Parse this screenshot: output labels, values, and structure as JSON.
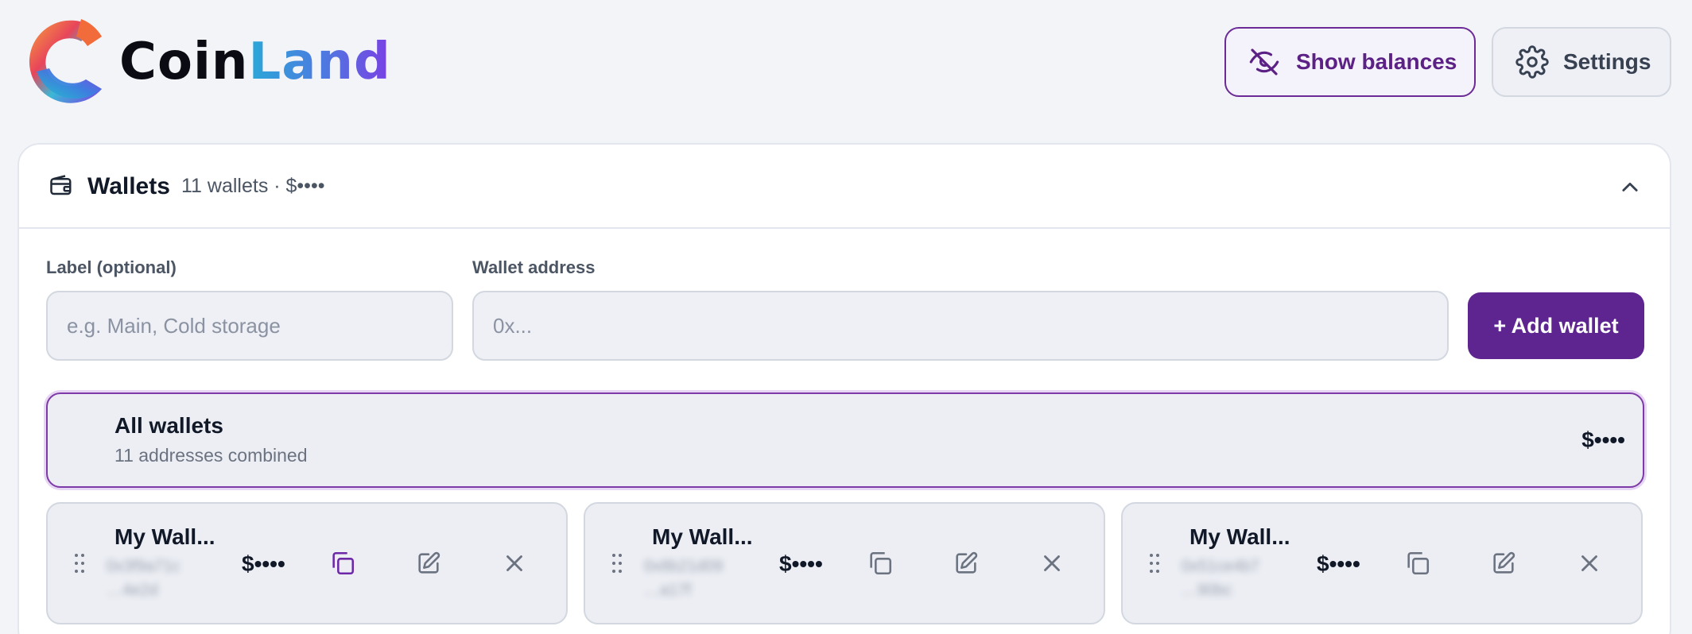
{
  "app": {
    "logo_text_1": "Coin",
    "logo_text_2": "Land",
    "brand_color": "#5e2590"
  },
  "header": {
    "show_balances_label": "Show balances",
    "settings_label": "Settings"
  },
  "wallets_panel": {
    "title": "Wallets",
    "meta": "11 wallets · $••••",
    "label_field": {
      "label": "Label (optional)",
      "placeholder": "e.g. Main, Cold storage",
      "value": ""
    },
    "address_field": {
      "label": "Wallet address",
      "placeholder": "0x...",
      "value": ""
    },
    "add_button_label": "+ Add wallet",
    "all_wallets": {
      "title": "All wallets",
      "subtitle": "11 addresses combined",
      "balance": "$••••"
    },
    "wallets": [
      {
        "name": "My Wall...",
        "address_line_1": "0x3f9a71c",
        "address_line_2": "…4e2d",
        "balance": "$••••"
      },
      {
        "name": "My Wall...",
        "address_line_1": "0x8b21d09",
        "address_line_2": "…a17f",
        "balance": "$••••"
      },
      {
        "name": "My Wall...",
        "address_line_1": "0x51ce4b7",
        "address_line_2": "…90bc",
        "balance": "$••••"
      }
    ]
  },
  "icons": {
    "show_balances": "eye-off-icon",
    "settings": "gear-icon",
    "wallet": "wallet-icon",
    "collapse": "chevron-up-icon",
    "drag": "drag-handle-icon",
    "copy": "copy-icon",
    "edit": "edit-icon",
    "remove": "close-icon"
  }
}
